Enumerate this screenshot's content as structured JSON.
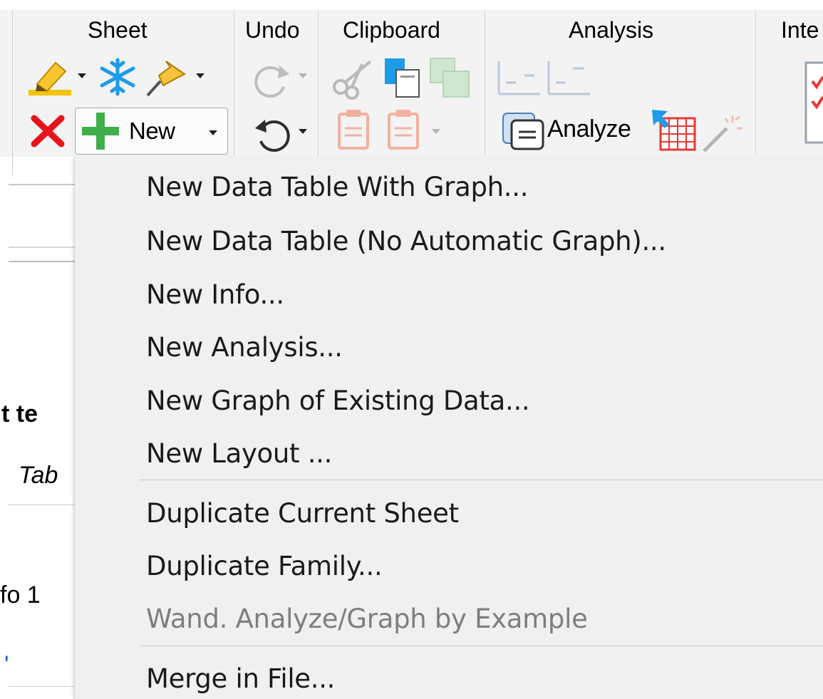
{
  "ribbon": {
    "groups": {
      "sheet": "Sheet",
      "undo": "Undo",
      "clipboard": "Clipboard",
      "analysis": "Analysis",
      "interpret": "Inte"
    },
    "new_button_label": "New",
    "analyze_button_label": "Analyze"
  },
  "background": {
    "heading_fragment": "t te",
    "italic_fragment": "Tab",
    "info_fragment": "fo 1",
    "link_fragment": "'"
  },
  "new_menu": {
    "items": [
      "New Data Table With Graph...",
      "New Data Table (No Automatic Graph)...",
      "New Info...",
      "New Analysis...",
      "New Graph of Existing Data...",
      "New Layout ...",
      "Duplicate Current Sheet",
      "Duplicate Family...",
      "Wand. Analyze/Graph by Example",
      "Merge in File..."
    ],
    "disabled_item": "Wand. Analyze/Graph by Example"
  },
  "colors": {
    "ribbon_bg": "#f3f3f3",
    "menu_bg": "#f0f0f0",
    "delete_red": "#e8141c",
    "new_green": "#3fae49",
    "snow_blue": "#1e9be9",
    "disabled_text": "#7e7e7e"
  }
}
